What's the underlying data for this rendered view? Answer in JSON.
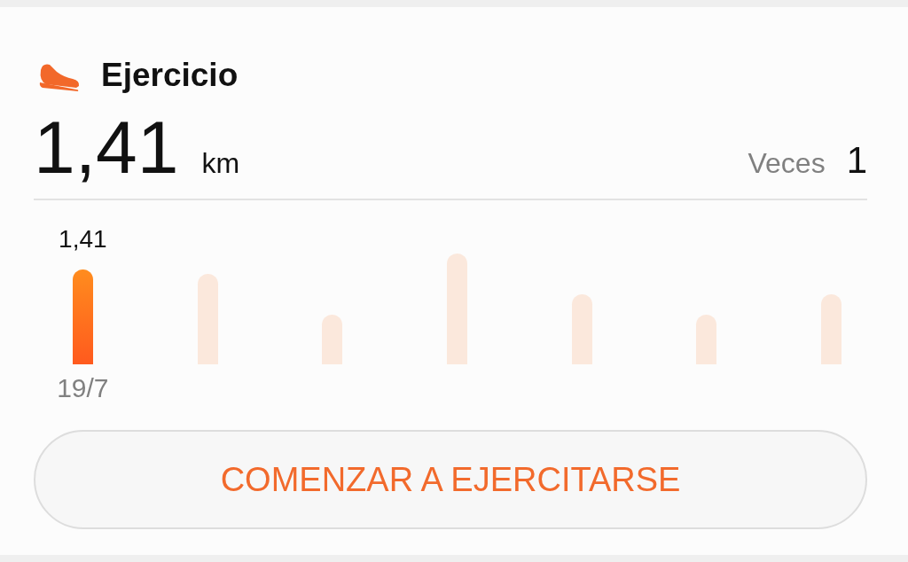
{
  "card": {
    "title": "Ejercicio",
    "distance": "1,41",
    "unit": "km",
    "count_label": "Veces",
    "count": "1"
  },
  "bars": [
    {
      "selected": true,
      "value": "1,41",
      "date": "19/7"
    },
    {
      "selected": false
    },
    {
      "selected": false
    },
    {
      "selected": false
    },
    {
      "selected": false
    },
    {
      "selected": false
    },
    {
      "selected": false
    }
  ],
  "button": "COMENZAR A EJERCITARSE"
}
